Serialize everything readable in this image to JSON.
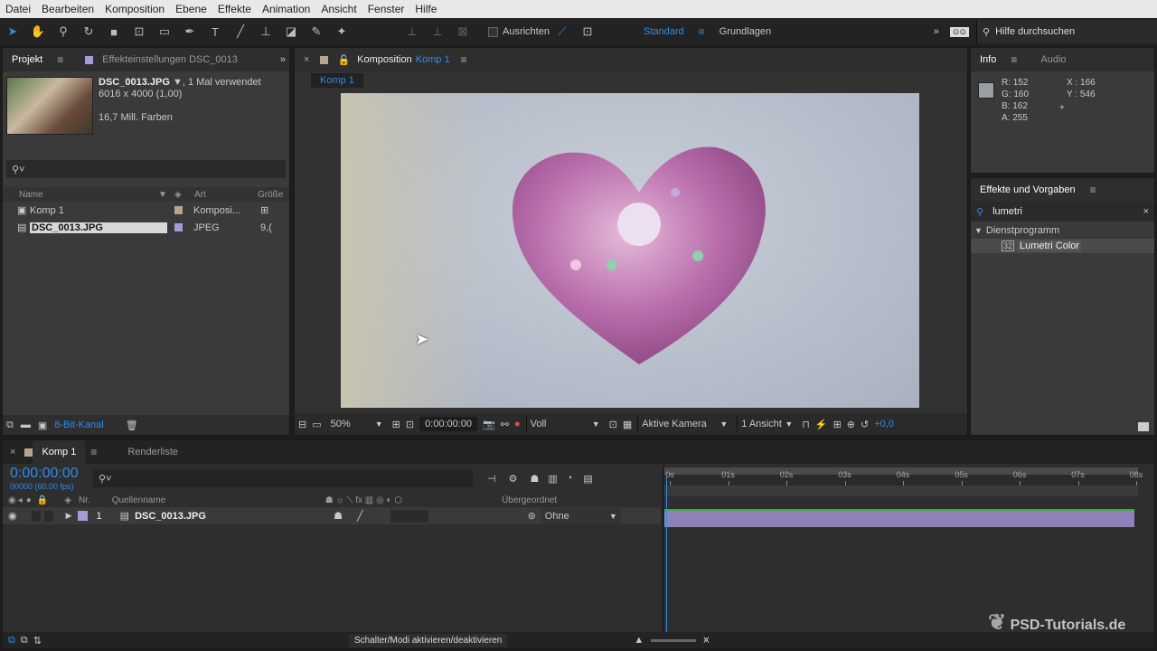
{
  "menu": [
    "Datei",
    "Bearbeiten",
    "Komposition",
    "Ebene",
    "Effekte",
    "Animation",
    "Ansicht",
    "Fenster",
    "Hilfe"
  ],
  "toolbar": {
    "align_label": "Ausrichten",
    "workspace_active": "Standard",
    "workspace_other": "Grundlagen",
    "help_search_placeholder": "Hilfe durchsuchen"
  },
  "project": {
    "tab_project": "Projekt",
    "tab_effects": "Effekteinstellungen DSC_0013",
    "asset_name": "DSC_0013.JPG",
    "asset_usage": ", 1 Mal verwendet",
    "asset_dims": "6016 x 4000 (1,00)",
    "asset_colors": "16,7 Mill. Farben",
    "columns": {
      "name": "Name",
      "type": "Art",
      "size": "Größe"
    },
    "items": [
      {
        "name": "Komp 1",
        "type": "Komposi...",
        "color": "#b5a68a",
        "size": ""
      },
      {
        "name": "DSC_0013.JPG",
        "type": "JPEG",
        "color": "#a89ad8",
        "size": "9,("
      }
    ],
    "bit_depth": "8-Bit-Kanal"
  },
  "composition": {
    "tab_label": "Komposition",
    "comp_name": "Komp 1",
    "sub_tab": "Komp 1",
    "zoom": "50%",
    "timecode": "0:00:00:00",
    "resolution": "Voll",
    "camera": "Aktive Kamera",
    "views": "1 Ansicht",
    "exposure": "+0,0"
  },
  "info": {
    "tab_info": "Info",
    "tab_audio": "Audio",
    "r": "R: 152",
    "g": "G: 160",
    "b": "B: 162",
    "a": "A: 255",
    "x": "X : 166",
    "y": "Y : 546",
    "swatch": "#989fa2"
  },
  "effects": {
    "title": "Effekte und Vorgaben",
    "search_value": "lumetri",
    "category": "Dienstprogramm",
    "effect": "Lumetri Color"
  },
  "timeline": {
    "tab_comp": "Komp 1",
    "tab_render": "Renderliste",
    "timecode": "0:00:00:00",
    "frames": "00000 (60.00 fps)",
    "col_nr": "Nr.",
    "col_source": "Quellenname",
    "col_parent": "Übergeordnet",
    "layer_nr": "1",
    "layer_name": "DSC_0013.JPG",
    "parent_value": "Ohne",
    "ruler": [
      "0s",
      "01s",
      "02s",
      "03s",
      "04s",
      "05s",
      "06s",
      "07s",
      "08s"
    ],
    "footer_toggle": "Schalter/Modi aktivieren/deaktivieren",
    "watermark": "PSD-Tutorials.de"
  }
}
